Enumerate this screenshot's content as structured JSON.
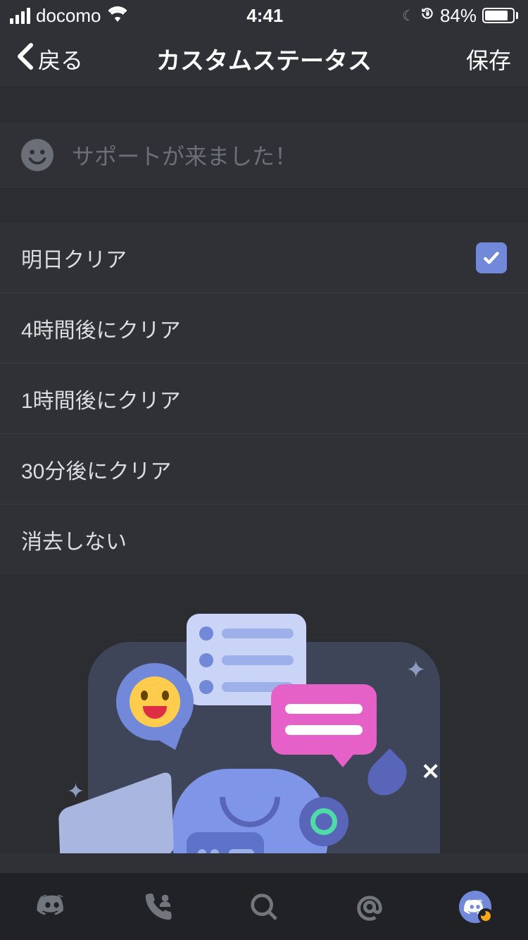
{
  "status_bar": {
    "carrier": "docomo",
    "time": "4:41",
    "battery_percent": "84%"
  },
  "header": {
    "back_label": "戻る",
    "title": "カスタムステータス",
    "save_label": "保存"
  },
  "status_input": {
    "placeholder": "サポートが来ました！"
  },
  "clear_options": [
    {
      "label": "明日クリア",
      "selected": true
    },
    {
      "label": "4時間後にクリア",
      "selected": false
    },
    {
      "label": "1時間後にクリア",
      "selected": false
    },
    {
      "label": "30分後にクリア",
      "selected": false
    },
    {
      "label": "消去しない",
      "selected": false
    }
  ]
}
